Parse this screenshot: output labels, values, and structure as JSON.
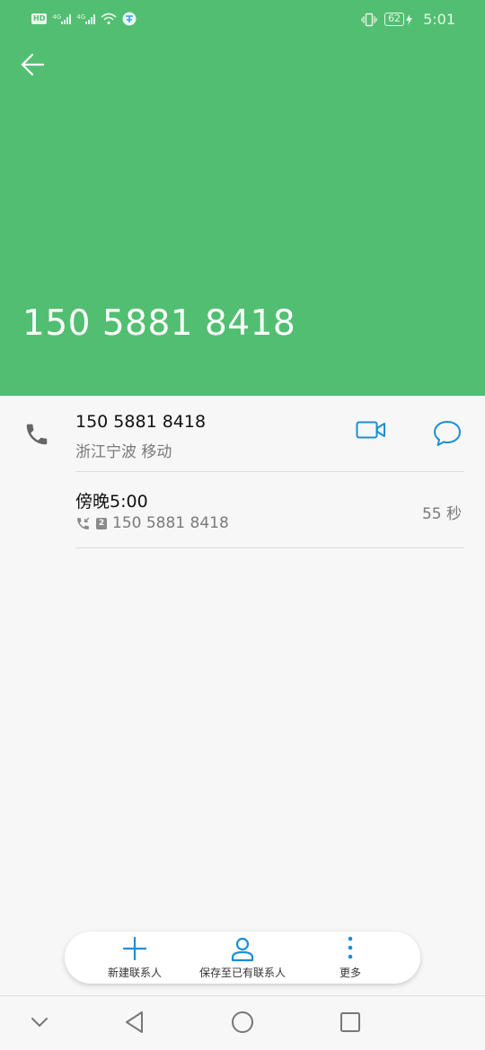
{
  "status_bar": {
    "hd": "HD",
    "network1": "4G",
    "network2": "4G",
    "battery": "62",
    "time": "5:01"
  },
  "header": {
    "title_number": "150 5881 8418"
  },
  "contact": {
    "number": "150 5881 8418",
    "location": "浙江宁波 移动"
  },
  "call_log": [
    {
      "time": "傍晚5:00",
      "sim": "2",
      "number": "150 5881 8418",
      "duration": "55 秒"
    }
  ],
  "actions": {
    "new_contact": "新建联系人",
    "save_existing": "保存至已有联系人",
    "more": "更多"
  },
  "colors": {
    "header_bg": "#52be71",
    "accent": "#1a8fd6"
  },
  "icons": [
    "back-arrow-icon",
    "phone-icon",
    "video-call-icon",
    "message-icon",
    "plus-icon",
    "person-icon",
    "more-vert-icon",
    "incoming-call-icon",
    "sim-2-icon"
  ]
}
